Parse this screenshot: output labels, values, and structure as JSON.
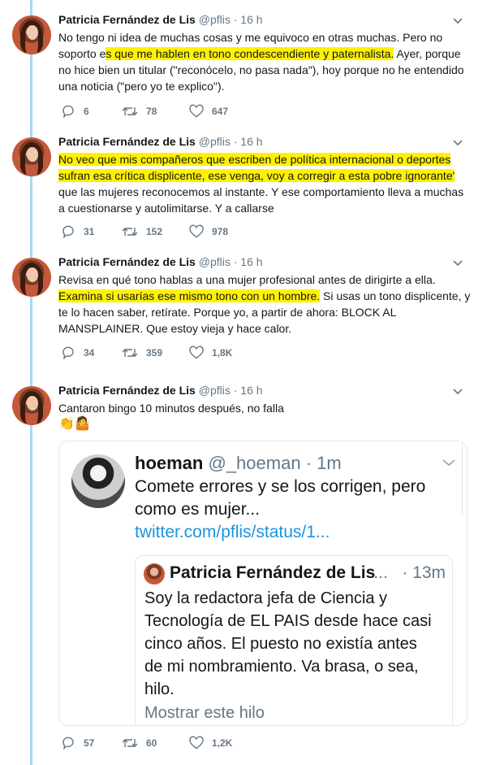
{
  "colors": {
    "accent": "#1b95e0",
    "highlight": "#fff200",
    "muted": "#657786",
    "thread": "#a6d9f7"
  },
  "tweets": [
    {
      "name": "Patricia Fernández de Lis",
      "handle": "@pflis",
      "time": "· 16 h",
      "text": [
        {
          "t": "No tengo ni idea de muchas cosas y me equivoco en otras muchas. Pero no soporto e",
          "hl": false
        },
        {
          "t": "s que me hablen en tono condescendiente y paternalista.",
          "hl": true
        },
        {
          "t": " Ayer, porque no hice bien un titular (\"reconócelo, no pasa nada\"), hoy porque no he entendido una noticia (\"pero yo te explico\").",
          "hl": false
        }
      ],
      "replies": "6",
      "retweets": "78",
      "likes": "647"
    },
    {
      "name": "Patricia Fernández de Lis",
      "handle": "@pflis",
      "time": "· 16 h",
      "text": [
        {
          "t": "No veo que mis compañeros que escriben de política internacional o deportes sufran esa crítica displicente, ese venga, voy a corregir a esta pobre ignorante'",
          "hl": true
        },
        {
          "t": " que las mujeres reconocemos al instante. Y ese comportamiento lleva a muchas a cuestionarse y autolimitarse. Y a callarse",
          "hl": false
        }
      ],
      "replies": "31",
      "retweets": "152",
      "likes": "978"
    },
    {
      "name": "Patricia Fernández de Lis",
      "handle": "@pflis",
      "time": "· 16 h",
      "text": [
        {
          "t": "Revisa en qué tono hablas a una mujer profesional antes de dirigirte a ella. ",
          "hl": false
        },
        {
          "t": "Examina si usarías ese mismo tono con un hombre.",
          "hl": true
        },
        {
          "t": " Si usas un tono displicente, y te lo hacen saber, retírate. Porque yo, a partir de ahora: BLOCK AL MANSPLAINER. Que estoy vieja y hace calor.",
          "hl": false
        }
      ],
      "replies": "34",
      "retweets": "359",
      "likes": "1,8K"
    },
    {
      "name": "Patricia Fernández de Lis",
      "handle": "@pflis",
      "time": "· 16 h",
      "text": [
        {
          "t": "Cantaron bingo 10 minutos después, no falla",
          "hl": false
        }
      ],
      "emoji": "👏🤷",
      "replies": "57",
      "retweets": "60",
      "likes": "1,2K"
    }
  ],
  "embedded": {
    "name": "hoeman",
    "handle": "@_hoeman",
    "time": "· 1m",
    "text": "Comete errores y se los corrigen, pero como es mujer...",
    "link": "twitter.com/pflis/status/1...",
    "quote": {
      "name": "Patricia Fernández de Lis",
      "ellipsis": "...",
      "time": "· 13m",
      "text": "Soy la redactora jefa de Ciencia y Tecnología de EL PAIS desde hace casi cinco años. El puesto no existía antes de mi nombramiento. Va brasa, o sea, hilo.",
      "more": "Mostrar este hilo"
    }
  }
}
